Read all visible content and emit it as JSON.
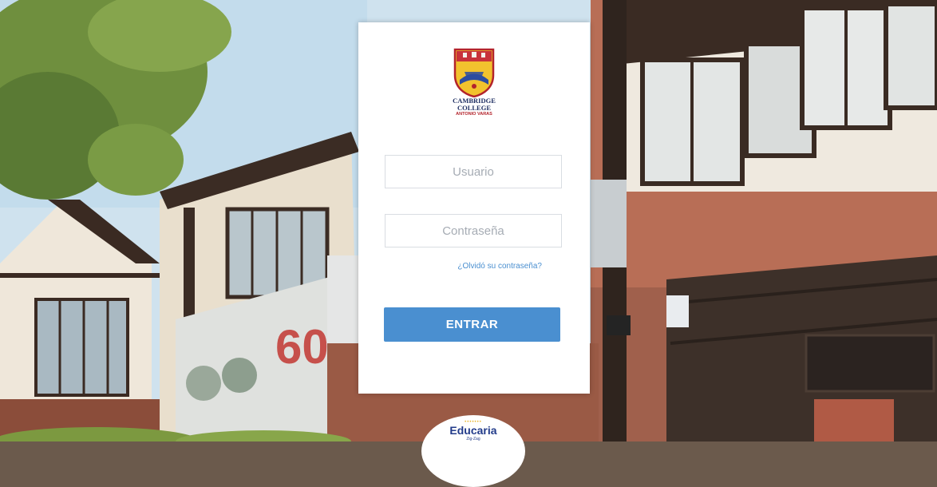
{
  "logo": {
    "line1": "CAMBRIDGE",
    "line2": "COLLEGE",
    "line3": "ANTONIO VARAS"
  },
  "form": {
    "username_placeholder": "Usuario",
    "password_placeholder": "Contraseña",
    "forgot_label": "¿Olvidó su contraseña?",
    "submit_label": "ENTRAR"
  },
  "footer_badge": {
    "title": "Educaria",
    "subtitle": "Zig-Zag"
  },
  "colors": {
    "accent": "#4a8fd0",
    "card": "#ffffff",
    "input_border": "#d9dde2",
    "logo_navy": "#1f2f63",
    "logo_red": "#b3232b"
  }
}
